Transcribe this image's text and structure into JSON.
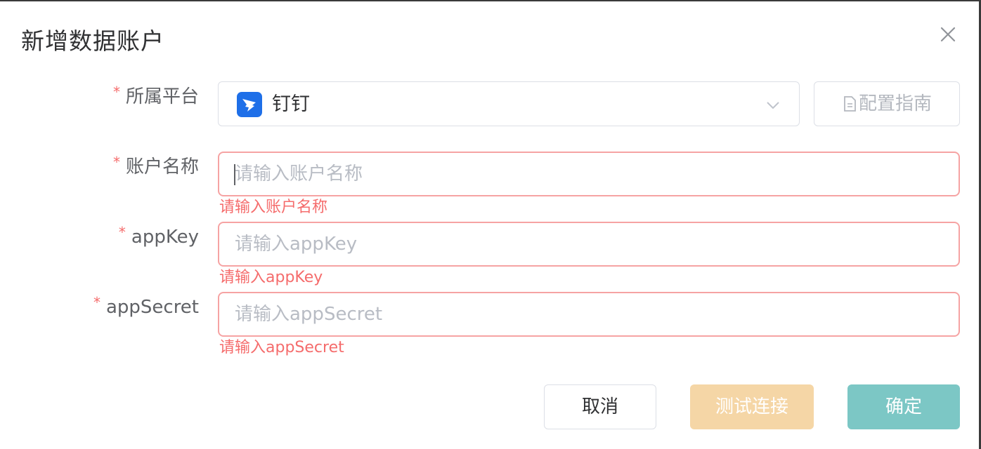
{
  "dialog": {
    "title": "新增数据账户"
  },
  "form": {
    "platform": {
      "label": "所属平台",
      "required_mark": "*",
      "selected_value": "钉钉",
      "platform_icon": "dingtalk-logo",
      "guide_button_label": "配置指南",
      "guide_icon": "document-icon"
    },
    "account_name": {
      "label": "账户名称",
      "required_mark": "*",
      "placeholder": "请输入账户名称",
      "value": "",
      "error": "请输入账户名称"
    },
    "app_key": {
      "label": "appKey",
      "required_mark": "*",
      "placeholder": "请输入appKey",
      "value": "",
      "error": "请输入appKey"
    },
    "app_secret": {
      "label": "appSecret",
      "required_mark": "*",
      "placeholder": "请输入appSecret",
      "value": "",
      "error": "请输入appSecret"
    }
  },
  "footer": {
    "cancel_label": "取消",
    "test_label": "测试连接",
    "confirm_label": "确定"
  },
  "colors": {
    "error": "#f56c6c",
    "error_border": "#f6a3a3",
    "test_button": "#f5d6a6",
    "confirm_button": "#7cc7c5",
    "dingtalk_blue": "#1e6fe8"
  }
}
